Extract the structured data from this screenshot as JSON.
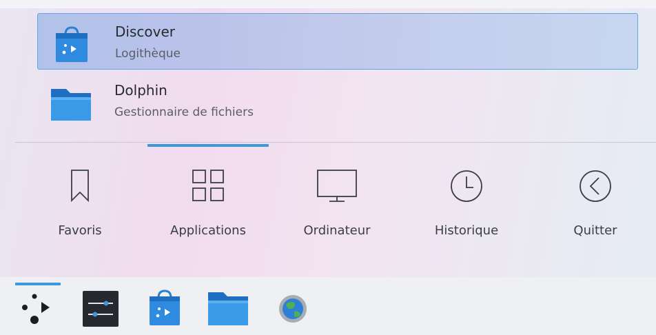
{
  "results": [
    {
      "name": "Discover",
      "description": "Logithèque",
      "icon": "discover-bag-icon",
      "selected": true
    },
    {
      "name": "Dolphin",
      "description": "Gestionnaire de fichiers",
      "icon": "folder-icon",
      "selected": false
    }
  ],
  "tabs": [
    {
      "label": "Favoris",
      "icon": "bookmark-icon"
    },
    {
      "label": "Applications",
      "icon": "grid-icon",
      "active": true
    },
    {
      "label": "Ordinateur",
      "icon": "monitor-icon"
    },
    {
      "label": "Historique",
      "icon": "clock-icon"
    },
    {
      "label": "Quitter",
      "icon": "back-circle-icon"
    }
  ],
  "taskbar": {
    "items": [
      {
        "name": "application-launcher",
        "icon": "kde-launcher-icon",
        "active": true
      },
      {
        "name": "system-settings",
        "icon": "settings-sliders-icon"
      },
      {
        "name": "discover",
        "icon": "discover-bag-icon"
      },
      {
        "name": "dolphin",
        "icon": "folder-icon"
      },
      {
        "name": "web-browser",
        "icon": "globe-icon"
      }
    ]
  },
  "colors": {
    "accent": "#3d97dc",
    "selection_border": "#5fa6e6",
    "icon_blue": "#2f8be0"
  }
}
